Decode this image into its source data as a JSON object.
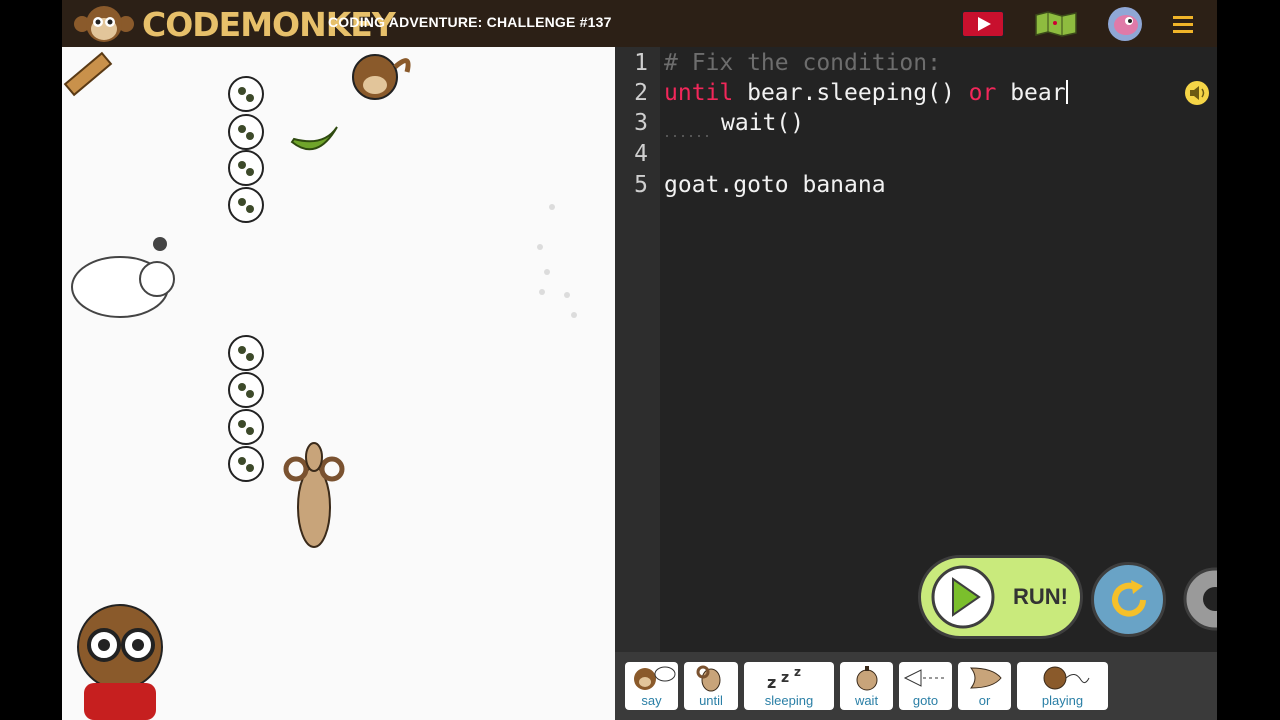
{
  "header": {
    "logo_text": "CODEMONKEY",
    "challenge_title": "CODING ADVENTURE: CHALLENGE #137",
    "video_icon": "play-video-icon",
    "map_icon": "map-icon",
    "avatar_icon": "user-avatar-icon",
    "menu_icon": "hamburger-menu-icon"
  },
  "editor": {
    "line_numbers": [
      "1",
      "2",
      "3",
      "4",
      "5"
    ],
    "line1_comment": "# Fix the condition:",
    "line2_kw_until": "until",
    "line2_expr1": " bear.sleeping() ",
    "line2_kw_or": "or",
    "line2_expr2": " bear",
    "line3": "wait()",
    "line5": "goat.goto banana",
    "sound_icon": "speaker-icon"
  },
  "palette": {
    "items": [
      {
        "label": "say",
        "icon": "monkey-speech-icon"
      },
      {
        "label": "until",
        "icon": "goat-icon"
      },
      {
        "label": "sleeping",
        "icon": "zzz-icon"
      },
      {
        "label": "wait",
        "icon": "stopwatch-icon"
      },
      {
        "label": "goto",
        "icon": "goto-arrow-icon"
      },
      {
        "label": "or",
        "icon": "or-gate-icon"
      },
      {
        "label": "playing",
        "icon": "ball-of-yarn-icon"
      }
    ]
  },
  "controls": {
    "run_label": "RUN!",
    "reset_icon": "reset-arrow-icon",
    "settings_icon": "gear-icon"
  },
  "colors": {
    "accent_green": "#c9ea7c",
    "keyword": "#f2275a",
    "topbar": "#2c2016",
    "logo": "#e7c06a"
  }
}
